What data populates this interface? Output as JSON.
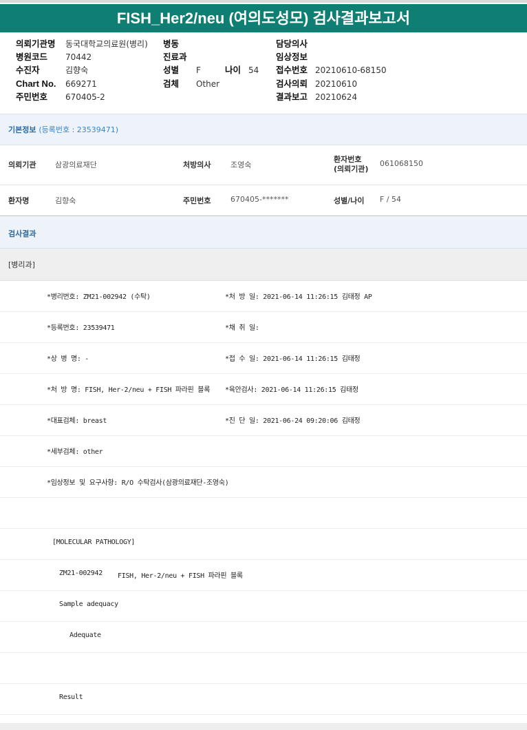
{
  "title": "FISH_Her2/neu (여의도성모) 검사결과보고서",
  "header": {
    "hospital_label": "의뢰기관명",
    "hospital_value": "동국대학교의료원(병리)",
    "code_label": "병원코드",
    "code_value": "70442",
    "receiver_label": "수진자",
    "receiver_value": "김향숙",
    "chart_label": "Chart No.",
    "chart_value": "669271",
    "jumin_label": "주민번호",
    "jumin_value": "670405-2",
    "ward_label": "병동",
    "dept_label": "진료과",
    "sex_label": "성별",
    "sex_value": "F",
    "age_label": "나이",
    "age_value": "54",
    "specimen_label": "검체",
    "specimen_value": "Other",
    "doctor_label": "담당의사",
    "clinical_label": "임상정보",
    "accession_label": "접수번호",
    "accession_value": "20210610-68150",
    "request_label": "검사의뢰",
    "request_value": "20210610",
    "report_label": "결과보고",
    "report_value": "20210624"
  },
  "basic_info": {
    "title": "기본정보",
    "reg": "(등록번호 : 23539471)",
    "rows": [
      {
        "k1": "의뢰기관",
        "v1": "삼광의료재단",
        "k2": "처방의사",
        "v2": "조영숙",
        "k3a": "환자번호",
        "k3b": "(의뢰기관)",
        "v3": "061068150"
      },
      {
        "k1": "환자명",
        "v1": "김향숙",
        "k2": "주민번호",
        "v2": "670405-*******",
        "k3": "성별/나이",
        "v3": "F / 54"
      }
    ]
  },
  "results": {
    "title": "검사결과",
    "section": "[병리과]",
    "lines": [
      {
        "left": "*병리번호: ZM21-002942 (수탁)",
        "right": "*처 방 일: 2021-06-14 11:26:15  김태정 AP"
      },
      {
        "left": "*등록번호: 23539471",
        "right": "*채 취 일:"
      },
      {
        "left": "*상 병 명: -",
        "right": "*접 수 일: 2021-06-14 11:26:15  김태정"
      },
      {
        "left": "*처 방 명: FISH, Her-2/neu + FISH 파라핀 블록",
        "right": "*육안검사: 2021-06-14 11:26:15  김태정"
      },
      {
        "left": "*대표검체: breast",
        "right": "*진 단 일: 2021-06-24 09:20:06  김태정"
      },
      {
        "left": "*세부검체: other",
        "right": ""
      },
      {
        "left": "*임상정보 및 요구사항: R/O 수탁검사(삼광의료재단-조영숙)",
        "right": ""
      }
    ],
    "molecular": "[MOLECULAR PATHOLOGY]",
    "case_no": "ZM21-002942",
    "case_name": "FISH, Her-2/neu + FISH 파라핀 블록",
    "sample_adequacy": "Sample adequacy",
    "adequate": "Adequate",
    "result": "Result"
  }
}
